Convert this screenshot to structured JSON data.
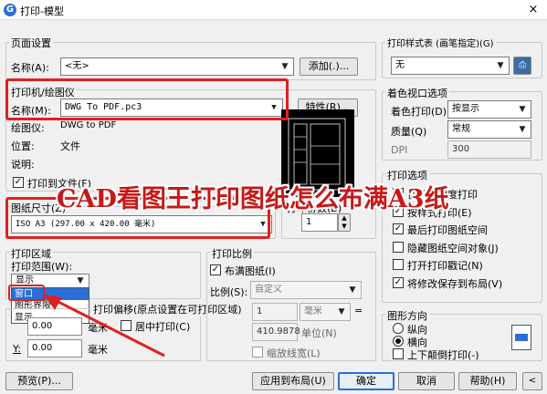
{
  "window": {
    "title": "打印-模型",
    "close": "×"
  },
  "page_setup": {
    "label": "页面设置",
    "name_label": "名称(A):",
    "name_value": "<无>",
    "add_button": "添加(.)..."
  },
  "printer": {
    "label": "打印机/绘图仪",
    "name_label": "名称(M):",
    "name_value": "DWG To PDF.pc3",
    "properties_button": "特性(R)...",
    "plotter_label": "绘图仪:",
    "plotter_value": "DWG to PDF",
    "location_label": "位置:",
    "location_value": "文件",
    "description_label": "说明:",
    "print_to_file_label": "打印到文件(F)"
  },
  "paper_size": {
    "label": "图纸尺寸(Z)",
    "value": "ISO A3 (297.00 x 420.00 毫米)"
  },
  "copies": {
    "label": "打印份数(B)",
    "value": "1"
  },
  "plot_area": {
    "label": "打印区域",
    "range_label": "打印范围(W):",
    "range_value": "显示",
    "options": [
      "窗口",
      "图形界限",
      "显示"
    ],
    "highlighted": "窗口"
  },
  "plot_offset": {
    "label": "打印偏移(原点设置在可打印区域)",
    "x_value": "0.00",
    "y_label": "Y:",
    "y_value": "0.00",
    "unit": "毫米",
    "center_label": "居中打印(C)"
  },
  "plot_scale": {
    "label": "打印比例",
    "fit_paper_label": "布满图纸(I)",
    "scale_label": "比例(S):",
    "scale_value": "自定义",
    "value1": "1",
    "unit": "毫米",
    "equals": "=",
    "value2": "410.9878",
    "unit_label": "单位(N)",
    "lineweights_label": "缩放线宽(L)"
  },
  "plot_style": {
    "label": "打印样式表 (画笔指定)(G)",
    "value": "无"
  },
  "shaded_viewport": {
    "label": "着色视口选项",
    "shade_label": "着色打印(D)",
    "shade_value": "按显示",
    "quality_label": "质量(Q)",
    "quality_value": "常规",
    "dpi_label": "DPI",
    "dpi_value": "300"
  },
  "plot_options": {
    "label": "打印选项",
    "items": [
      {
        "label": "使用透明度打印",
        "checked": false
      },
      {
        "label": "按样式打印(E)",
        "checked": true
      },
      {
        "label": "最后打印图纸空间",
        "checked": true
      },
      {
        "label": "隐藏图纸空间对象(J)",
        "checked": false
      },
      {
        "label": "打开打印戳记(N)",
        "checked": false
      },
      {
        "label": "将修改保存到布局(V)",
        "checked": true
      }
    ]
  },
  "orientation": {
    "label": "图形方向",
    "portrait": "纵向",
    "landscape": "横向",
    "upside_down": "上下颠倒打印(-)"
  },
  "buttons": {
    "preview": "预览(P)...",
    "apply_layout": "应用到布局(U)",
    "ok": "确定",
    "cancel": "取消",
    "help": "帮助(H)"
  },
  "overlay": {
    "text": "CAD看图王打印图纸怎么布满A3纸"
  },
  "colors": {
    "highlight_red": "#e02020",
    "selection_blue": "#2a6ed8"
  }
}
